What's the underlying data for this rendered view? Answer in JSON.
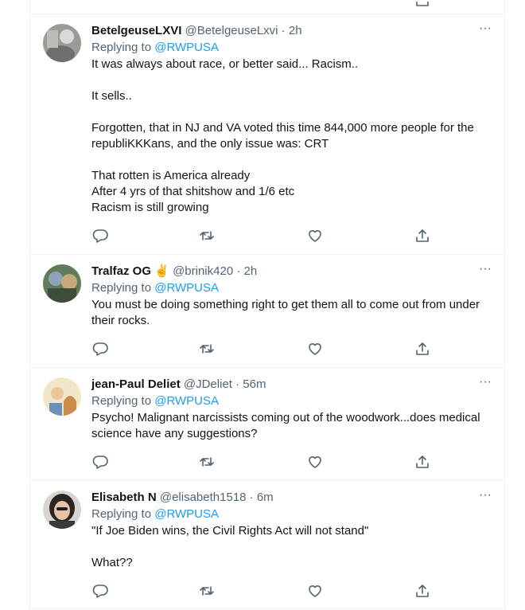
{
  "tweets": [
    {
      "name": "BetelgeuseLXVI",
      "handle": "@BetelgeuseLxvi",
      "sep": " · ",
      "time": "2h",
      "replying_prefix": "Replying to ",
      "replying_to": "@RWPUSA",
      "lines": [
        "It was always about race, or better said... Racism..",
        "",
        "It sells..",
        "",
        "Forgotten, that in NJ and VA voted this time 844,000 more people for the",
        "republiKKKans, and the only issue was:  CRT",
        "",
        "That rotten is America already",
        "After 4 yrs of that shitshow and 1/6 etc",
        "Racism is still growing"
      ],
      "more": "···"
    },
    {
      "name": "Tralfaz OG",
      "emoji": "✌️",
      "handle": "@brinik420",
      "sep": " · ",
      "time": "2h",
      "replying_prefix": "Replying to ",
      "replying_to": "@RWPUSA",
      "lines": [
        "You must be doing something right to get them all to come out from under",
        "their rocks."
      ],
      "more": "···"
    },
    {
      "name": "jean-Paul Deliet",
      "handle": "@JDeliet",
      "sep": " · ",
      "time": "56m",
      "replying_prefix": "Replying to ",
      "replying_to": "@RWPUSA",
      "lines": [
        "Psycho! Malignant narcissists coming out of the woodwork...does medical",
        "science have any suggestions?"
      ],
      "more": "···"
    },
    {
      "name": "Elisabeth N",
      "handle": "@elisabeth1518",
      "sep": " · ",
      "time": "6m",
      "replying_prefix": "Replying to ",
      "replying_to": "@RWPUSA",
      "lines": [
        "\"If Joe Biden wins, the Civil Rights Act will not stand\"",
        "",
        "What??"
      ],
      "more": "···"
    }
  ],
  "colors": {
    "text": "#0f1419",
    "secondary": "#536471",
    "link": "#1d9bf0",
    "border": "#eff3f4"
  },
  "icons": [
    "reply-icon",
    "retweet-icon",
    "like-icon",
    "share-icon",
    "more-icon"
  ]
}
